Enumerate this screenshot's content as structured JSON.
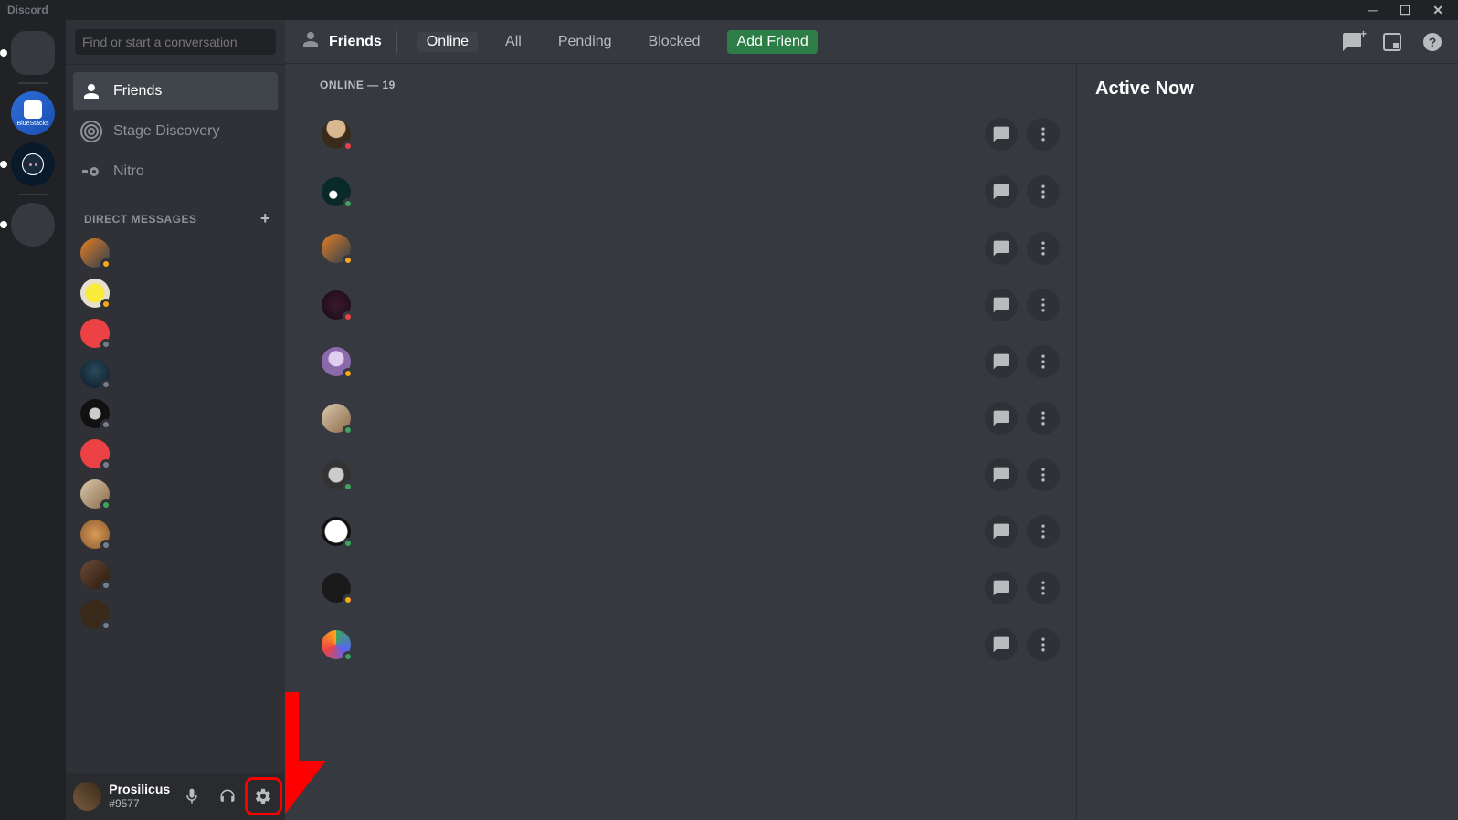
{
  "app": {
    "title": "Discord"
  },
  "search": {
    "placeholder": "Find or start a conversation"
  },
  "sidebar": {
    "friends": "Friends",
    "stage": "Stage Discovery",
    "nitro": "Nitro",
    "dm_header": "DIRECT MESSAGES"
  },
  "user": {
    "name": "Prosilicus",
    "tag": "#9577"
  },
  "header": {
    "friends": "Friends",
    "tabs": {
      "online": "Online",
      "all": "All",
      "pending": "Pending",
      "blocked": "Blocked"
    },
    "add_friend": "Add Friend"
  },
  "list": {
    "section": "ONLINE — 19"
  },
  "right": {
    "active_now": "Active Now"
  },
  "friends": [
    {
      "status": "dnd",
      "avatar": "av-1"
    },
    {
      "status": "online",
      "avatar": "av-2"
    },
    {
      "status": "idle",
      "avatar": "av-3"
    },
    {
      "status": "dnd",
      "avatar": "av-4"
    },
    {
      "status": "idle",
      "avatar": "av-5"
    },
    {
      "status": "online",
      "avatar": "av-6"
    },
    {
      "status": "online",
      "avatar": "av-7"
    },
    {
      "status": "online",
      "avatar": "av-8"
    },
    {
      "status": "idle",
      "avatar": "av-9"
    },
    {
      "status": "online",
      "avatar": "av-10"
    }
  ],
  "dms": [
    {
      "status": "idle",
      "avatar": "av-dm1"
    },
    {
      "status": "idle",
      "avatar": "av-dm2"
    },
    {
      "status": "offline",
      "avatar": "av-dm3"
    },
    {
      "status": "offline",
      "avatar": "av-dm4"
    },
    {
      "status": "offline",
      "avatar": "av-dm5"
    },
    {
      "status": "offline",
      "avatar": "av-dm6"
    },
    {
      "status": "online",
      "avatar": "av-dm7"
    },
    {
      "status": "offline",
      "avatar": "av-dm8"
    },
    {
      "status": "offline",
      "avatar": "av-dm9"
    },
    {
      "status": "offline",
      "avatar": "av-dm10"
    }
  ],
  "servers": [
    {
      "type": "home",
      "label": ""
    },
    {
      "type": "bluestacks",
      "label": "BlueStacks"
    },
    {
      "type": "opera",
      "label": ""
    },
    {
      "type": "plain",
      "label": ""
    }
  ]
}
